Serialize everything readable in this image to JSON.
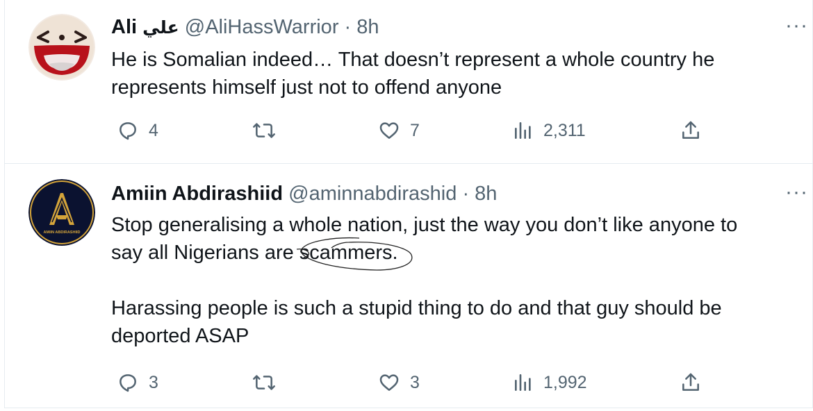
{
  "tweets": [
    {
      "display_name": "Ali",
      "display_name_arabic": "علي",
      "handle": "@AliHassWarrior",
      "separator": "·",
      "time": "8h",
      "text": "He is Somalian indeed… That doesn’t represent a whole country he\nrepresents himself just not to offend anyone",
      "more": "···",
      "replies": "4",
      "retweets": "",
      "likes": "7",
      "views": "2,311",
      "avatar_icon": "laughing-face-icon"
    },
    {
      "display_name": "Amiin Abdirashiid",
      "handle": "@aminnabdirashid",
      "separator": "·",
      "time": "8h",
      "text": "Stop generalising a whole nation, just the way you don’t like anyone to\nsay all Nigerians are scammers.\n\nHarassing people is such a stupid thing to do and that guy should be\ndeported ASAP",
      "more": "···",
      "replies": "3",
      "retweets": "",
      "likes": "3",
      "views": "1,992",
      "avatar_text": "AMIIN ABDIRASHIID",
      "avatar_icon": "gold-a-logo-icon"
    }
  ],
  "colors": {
    "text_primary": "#0f1419",
    "text_secondary": "#536471",
    "divider": "#e6ecf0",
    "avatar2_bg": "#0b1230",
    "avatar2_gold": "#d4a43a"
  }
}
